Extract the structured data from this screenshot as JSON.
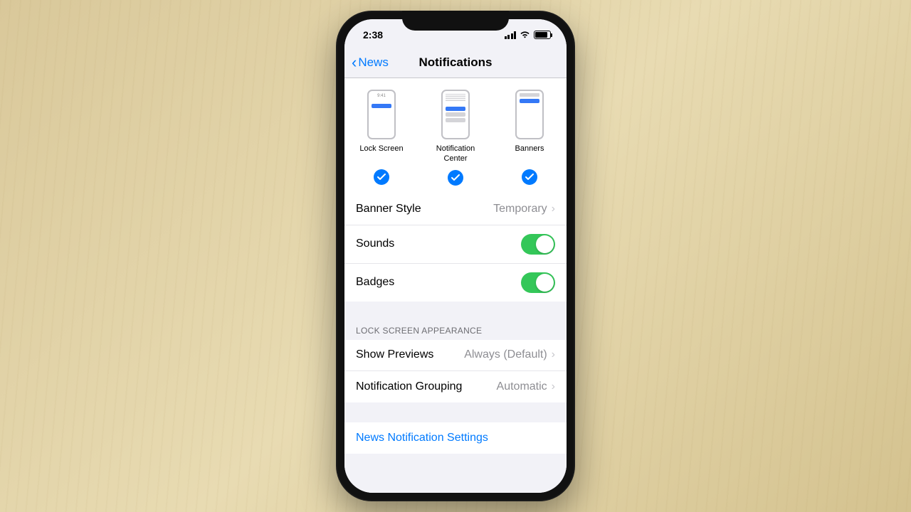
{
  "status": {
    "time": "2:38"
  },
  "nav": {
    "back_label": "News",
    "title": "Notifications"
  },
  "alerts": {
    "lock_screen": "Lock Screen",
    "notification_center": "Notification Center",
    "banners": "Banners",
    "mini_time": "9:41"
  },
  "rows": {
    "banner_style": {
      "label": "Banner Style",
      "value": "Temporary"
    },
    "sounds": {
      "label": "Sounds"
    },
    "badges": {
      "label": "Badges"
    }
  },
  "section_header": "LOCK SCREEN APPEARANCE",
  "appearance": {
    "show_previews": {
      "label": "Show Previews",
      "value": "Always (Default)"
    },
    "grouping": {
      "label": "Notification Grouping",
      "value": "Automatic"
    }
  },
  "footer_link": "News Notification Settings"
}
